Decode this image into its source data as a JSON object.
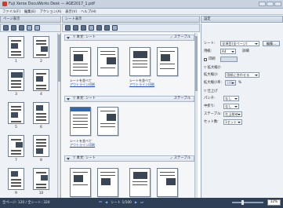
{
  "window": {
    "title": "Fuji Xerox DocuWorks Desk — AGE2017_1.pdf",
    "app_icon": "pdf-app-icon"
  },
  "menu": [
    "ファイル(F)",
    "編集(E)",
    "アクション(A)",
    "表示(V)",
    "ヘルプ(H)"
  ],
  "panels": {
    "pages_title": "ページ表示",
    "sheets_title": "シート表示",
    "settings_title": "設定"
  },
  "pages": [
    {
      "left": "1",
      "right": "2"
    },
    {
      "left": "3",
      "right": "4"
    },
    {
      "left": "5",
      "right": "6"
    },
    {
      "left": "7",
      "right": "8"
    },
    {
      "left": "9",
      "right": "10"
    }
  ],
  "sheets": [
    {
      "header": "▽ 本文: シート",
      "staple": "ステープル",
      "captions": [
        {
          "line1": "シートを並べて",
          "line2": "アウトライン印刷"
        },
        {
          "line1": "シートを並べて",
          "line2": "アウトライン印刷"
        }
      ]
    },
    {
      "header": "▽ 本文: シート",
      "staple": "ステープル",
      "captions": [
        {
          "line1": "シートを並べて",
          "line2": "アウトライン印刷"
        }
      ]
    },
    {
      "header": "▽ 本文: シート",
      "staple": "ステープル",
      "captions": []
    }
  ],
  "settings": {
    "sheet_label": "シート:",
    "sheet_value": "全項目(全ページ)",
    "edit_button": "編集...",
    "paper_label": "用紙:",
    "paper_value": "A4",
    "custom_label": "詳細",
    "print_label": "印刷",
    "section_layout": "▽ 拡大縮小",
    "scale_label": "拡大縮小:",
    "scale_value": "用紙に合わせる",
    "ratio_label": "拡大縮小率:",
    "ratio_value": "100",
    "ratio_unit": "%",
    "section_finish": "▽ 仕上げ",
    "punch_label": "パンチ:",
    "punch_value": "なし",
    "staple_label": "ステープル:",
    "staple_value": "左上斜め",
    "folding_label": "中折り:",
    "folding_value": "なし",
    "binding_label": "セット数:",
    "binding_value": "1セット"
  },
  "status": {
    "left_text": "全ページ: 120  /  全シート: 320",
    "nav_label": "シート 1/100",
    "zoom": "32%"
  }
}
